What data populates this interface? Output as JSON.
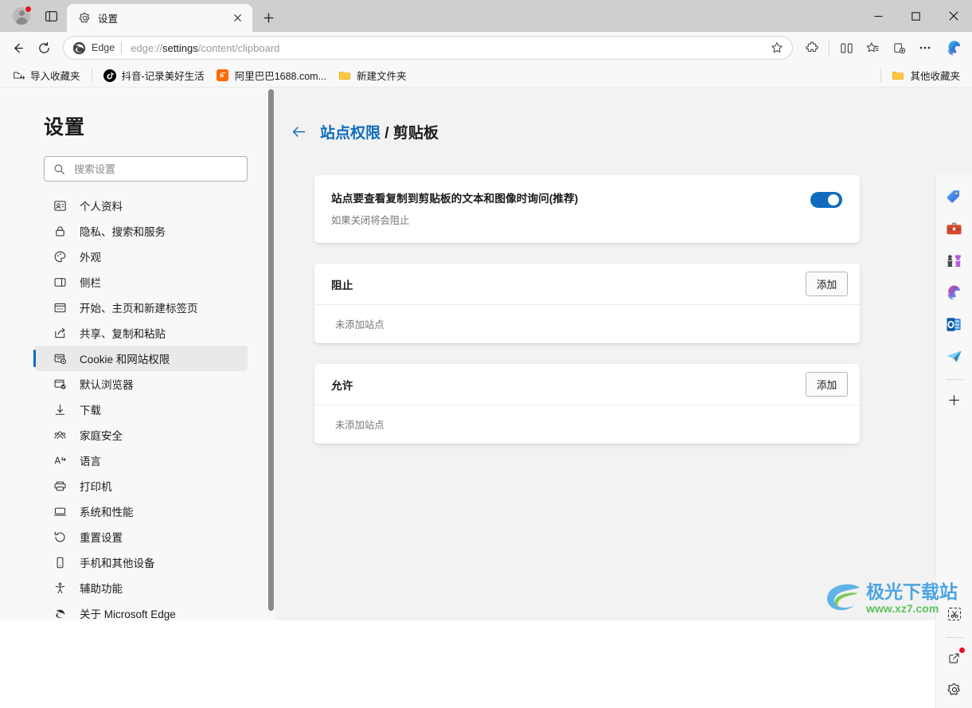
{
  "window": {
    "minimize_label": "最小化",
    "maximize_label": "最大化",
    "close_label": "关闭"
  },
  "tabbar": {
    "profile_label": "个人资料",
    "tab_search_label": "标签页搜索",
    "tabs": [
      {
        "title": "设置",
        "favicon": "gear-icon",
        "active": true
      }
    ],
    "close_tab_label": "关闭标签页",
    "new_tab_label": "新建标签页"
  },
  "toolbar": {
    "back_label": "返回",
    "refresh_label": "刷新",
    "edge_chip_label": "Edge",
    "url_prefix": "edge://",
    "url_bold": "settings",
    "url_suffix": "/content/clipboard",
    "url_full": "edge://settings/content/clipboard",
    "favorite_label": "添加到收藏夹",
    "extensions_label": "扩展",
    "split_screen_label": "拆分屏幕",
    "collections_label": "收藏集",
    "browser_essentials_label": "浏览器基本功能",
    "more_label": "设置及其他",
    "copilot_label": "Copilot"
  },
  "bookmarks": {
    "items": [
      {
        "label": "导入收藏夹",
        "icon": "import-favorites-icon"
      },
      {
        "label": "抖音-记录美好生活",
        "icon": "douyin-icon"
      },
      {
        "label": "阿里巴巴1688.com...",
        "icon": "alibaba-icon"
      },
      {
        "label": "新建文件夹",
        "icon": "folder-icon"
      }
    ],
    "other_favorites": {
      "label": "其他收藏夹",
      "icon": "folder-icon"
    }
  },
  "settings": {
    "title": "设置",
    "search": {
      "placeholder": "搜索设置",
      "value": ""
    },
    "nav_items": [
      {
        "label": "个人资料",
        "icon": "profile-icon",
        "active": false
      },
      {
        "label": "隐私、搜索和服务",
        "icon": "lock-icon",
        "active": false
      },
      {
        "label": "外观",
        "icon": "palette-icon",
        "active": false
      },
      {
        "label": "侧栏",
        "icon": "sidebar-icon",
        "active": false
      },
      {
        "label": "开始、主页和新建标签页",
        "icon": "home-page-icon",
        "active": false
      },
      {
        "label": "共享、复制和粘贴",
        "icon": "share-icon",
        "active": false
      },
      {
        "label": "Cookie 和网站权限",
        "icon": "cookie-permissions-icon",
        "active": true
      },
      {
        "label": "默认浏览器",
        "icon": "default-browser-icon",
        "active": false
      },
      {
        "label": "下载",
        "icon": "download-icon",
        "active": false
      },
      {
        "label": "家庭安全",
        "icon": "family-safety-icon",
        "active": false
      },
      {
        "label": "语言",
        "icon": "language-icon",
        "active": false
      },
      {
        "label": "打印机",
        "icon": "printer-icon",
        "active": false
      },
      {
        "label": "系统和性能",
        "icon": "system-icon",
        "active": false
      },
      {
        "label": "重置设置",
        "icon": "reset-icon",
        "active": false
      },
      {
        "label": "手机和其他设备",
        "icon": "phone-icon",
        "active": false
      },
      {
        "label": "辅助功能",
        "icon": "accessibility-icon",
        "active": false
      },
      {
        "label": "关于 Microsoft Edge",
        "icon": "edge-logo-icon",
        "active": false
      }
    ]
  },
  "content": {
    "back_label": "返回",
    "breadcrumb_parent": "站点权限",
    "breadcrumb_separator": " / ",
    "breadcrumb_current": "剪贴板",
    "toggle_card": {
      "title": "站点要查看复制到剪贴板的文本和图像时询问(推荐)",
      "subtitle": "如果关闭将会阻止",
      "enabled": true
    },
    "block_card": {
      "title": "阻止",
      "add_label": "添加",
      "empty_text": "未添加站点"
    },
    "allow_card": {
      "title": "允许",
      "add_label": "添加",
      "empty_text": "未添加站点"
    }
  },
  "edgebar": {
    "items": [
      {
        "icon": "shopping-tag-icon",
        "label": "购物"
      },
      {
        "icon": "briefcase-icon",
        "label": "工作区"
      },
      {
        "icon": "games-icon",
        "label": "游戏"
      },
      {
        "icon": "microsoft365-icon",
        "label": "Microsoft 365"
      },
      {
        "icon": "outlook-icon",
        "label": "Outlook"
      },
      {
        "icon": "telegram-icon",
        "label": "发送"
      }
    ],
    "add_label": "自定义",
    "screenshot_label": "屏幕截图",
    "open_new_window_label": "在新窗口中打开",
    "settings_label": "侧栏设置"
  },
  "colors": {
    "accent": "#0f6cbd",
    "titlebar": "#cfcfcf",
    "toolbar": "#f8f8f8",
    "page_bg": "#f2f2f2",
    "card_bg": "#ffffff",
    "notification_dot": "#e81123"
  },
  "watermark": {
    "main": "极光下载站",
    "sub": "www.xz7.com"
  }
}
